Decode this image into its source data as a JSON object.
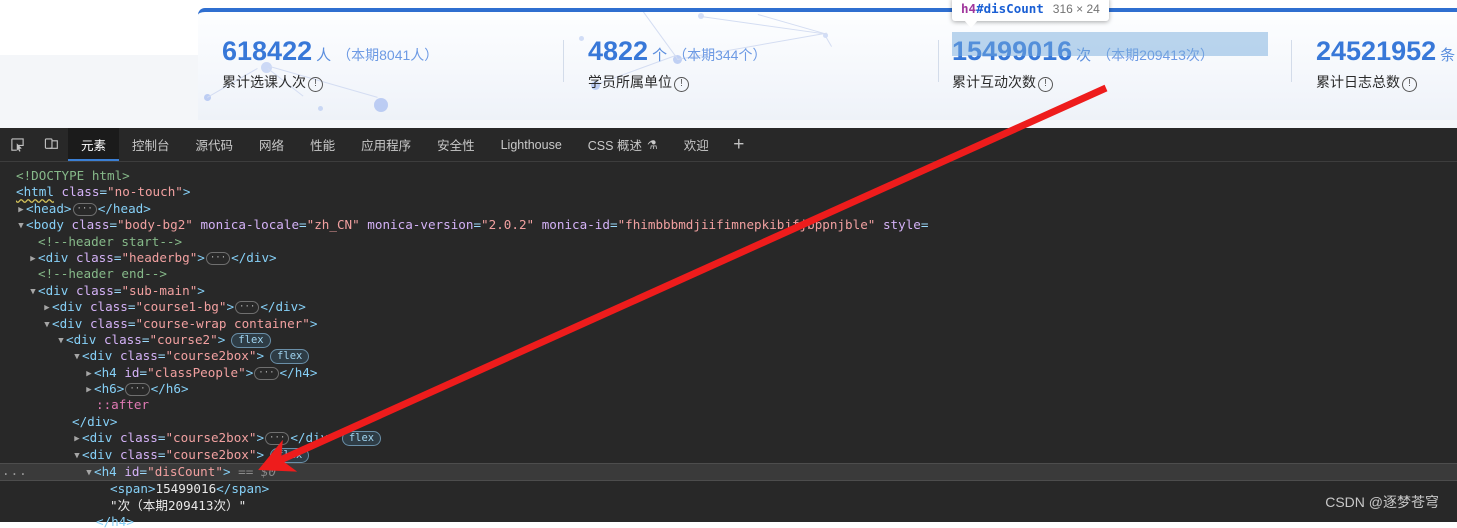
{
  "webpage": {
    "stats": [
      {
        "number": "618422",
        "unit": "人",
        "delta": "（本期8041人）",
        "label": "累计选课人次",
        "info_icon": "info-circle-icon"
      },
      {
        "number": "4822",
        "unit": "个",
        "delta": "（本期344个）",
        "label": "学员所属单位",
        "info_icon": "info-circle-icon"
      },
      {
        "number": "15499016",
        "unit": "次",
        "delta": "（本期209413次）",
        "label": "累计互动次数",
        "info_icon": "info-circle-icon"
      },
      {
        "number": "24521952",
        "unit": "条",
        "delta": "",
        "label": "累计日志总数",
        "info_icon": "info-circle-icon"
      }
    ],
    "highlight_tooltip": {
      "tag": "h4",
      "id": "#disCount",
      "dimensions": "316 × 24"
    },
    "accent_color": "#3878d8",
    "highlight_color": "#73aadc"
  },
  "devtools": {
    "toolbar_icons": [
      {
        "name": "inspect-element-icon"
      },
      {
        "name": "device-toolbar-icon"
      }
    ],
    "tabs": [
      {
        "label": "元素",
        "active": true
      },
      {
        "label": "控制台",
        "active": false
      },
      {
        "label": "源代码",
        "active": false
      },
      {
        "label": "网络",
        "active": false
      },
      {
        "label": "性能",
        "active": false
      },
      {
        "label": "应用程序",
        "active": false
      },
      {
        "label": "安全性",
        "active": false
      },
      {
        "label": "Lighthouse",
        "active": false
      },
      {
        "label": "CSS 概述",
        "active": false,
        "flask": "⚗"
      },
      {
        "label": "欢迎",
        "active": false
      }
    ],
    "add_tab_label": "+",
    "dom_lines": {
      "l1_doctype": "<!DOCTYPE html>",
      "l2_html_open": "<html",
      "l2_attr": "class",
      "l2_val": "\"no-touch\"",
      "l2_close": ">",
      "l3_head": "<head>",
      "l3_head_close": "</head>",
      "l4_body_tag": "<body",
      "l4_attr1": "class",
      "l4_val1": "\"body-bg2\"",
      "l4_attr2": "monica-locale",
      "l4_val2": "\"zh_CN\"",
      "l4_attr3": "monica-version",
      "l4_val3": "\"2.0.2\"",
      "l4_attr4": "monica-id",
      "l4_val4": "\"fhimbbbmdjiifimnepkibjfjbppnjble\"",
      "l4_attr5": "style",
      "l5_comment_start": "<!--header start-->",
      "l6_div_headerbg_open": "<div",
      "l6_attr": "class",
      "l6_val": "\"headerbg\"",
      "l6_gt": ">",
      "l6_close": "</div>",
      "l7_comment_end": "<!--header end-->",
      "l8_div_submain_open": "<div",
      "l8_attr": "class",
      "l8_val": "\"sub-main\"",
      "l8_gt": ">",
      "l9_div_course1bg_open": "<div",
      "l9_attr": "class",
      "l9_val": "\"course1-bg\"",
      "l9_gt": ">",
      "l9_close": "</div>",
      "l10_div_coursewrap_open": "<div",
      "l10_attr": "class",
      "l10_val": "\"course-wrap container\"",
      "l10_gt": ">",
      "l11_div_course2_open": "<div",
      "l11_attr": "class",
      "l11_val": "\"course2\"",
      "l11_gt": ">",
      "l11_badge": "flex",
      "l12_div_course2box_open": "<div",
      "l12_attr": "class",
      "l12_val": "\"course2box\"",
      "l12_gt": ">",
      "l12_badge": "flex",
      "l13_h4_open": "<h4",
      "l13_attr": "id",
      "l13_val": "\"classPeople\"",
      "l13_gt": ">",
      "l13_close": "</h4>",
      "l14_h6_open": "<h6>",
      "l14_close": "</h6>",
      "l15_after": "::after",
      "l16_div_close": "</div>",
      "l17_div_course2box_open": "<div",
      "l17_attr": "class",
      "l17_val": "\"course2box\"",
      "l17_gt": ">",
      "l17_close": "</div>",
      "l17_badge": "flex",
      "l18_div_course2box_open": "<div",
      "l18_attr": "class",
      "l18_val": "\"course2box\"",
      "l18_gt": ">",
      "l18_badge": "flex",
      "l19_h4_open": "<h4",
      "l19_attr": "id",
      "l19_val": "\"disCount\"",
      "l19_gt": ">",
      "l19_eq": "== $0",
      "l19_gutter": "...",
      "l20_span_open": "<span>",
      "l20_text": "15499016",
      "l20_span_close": "</span>",
      "l21_text": "\"次（本期209413次）\"",
      "l22_h4_close": "</h4>"
    }
  },
  "watermark": "CSDN @逐梦苍穹"
}
